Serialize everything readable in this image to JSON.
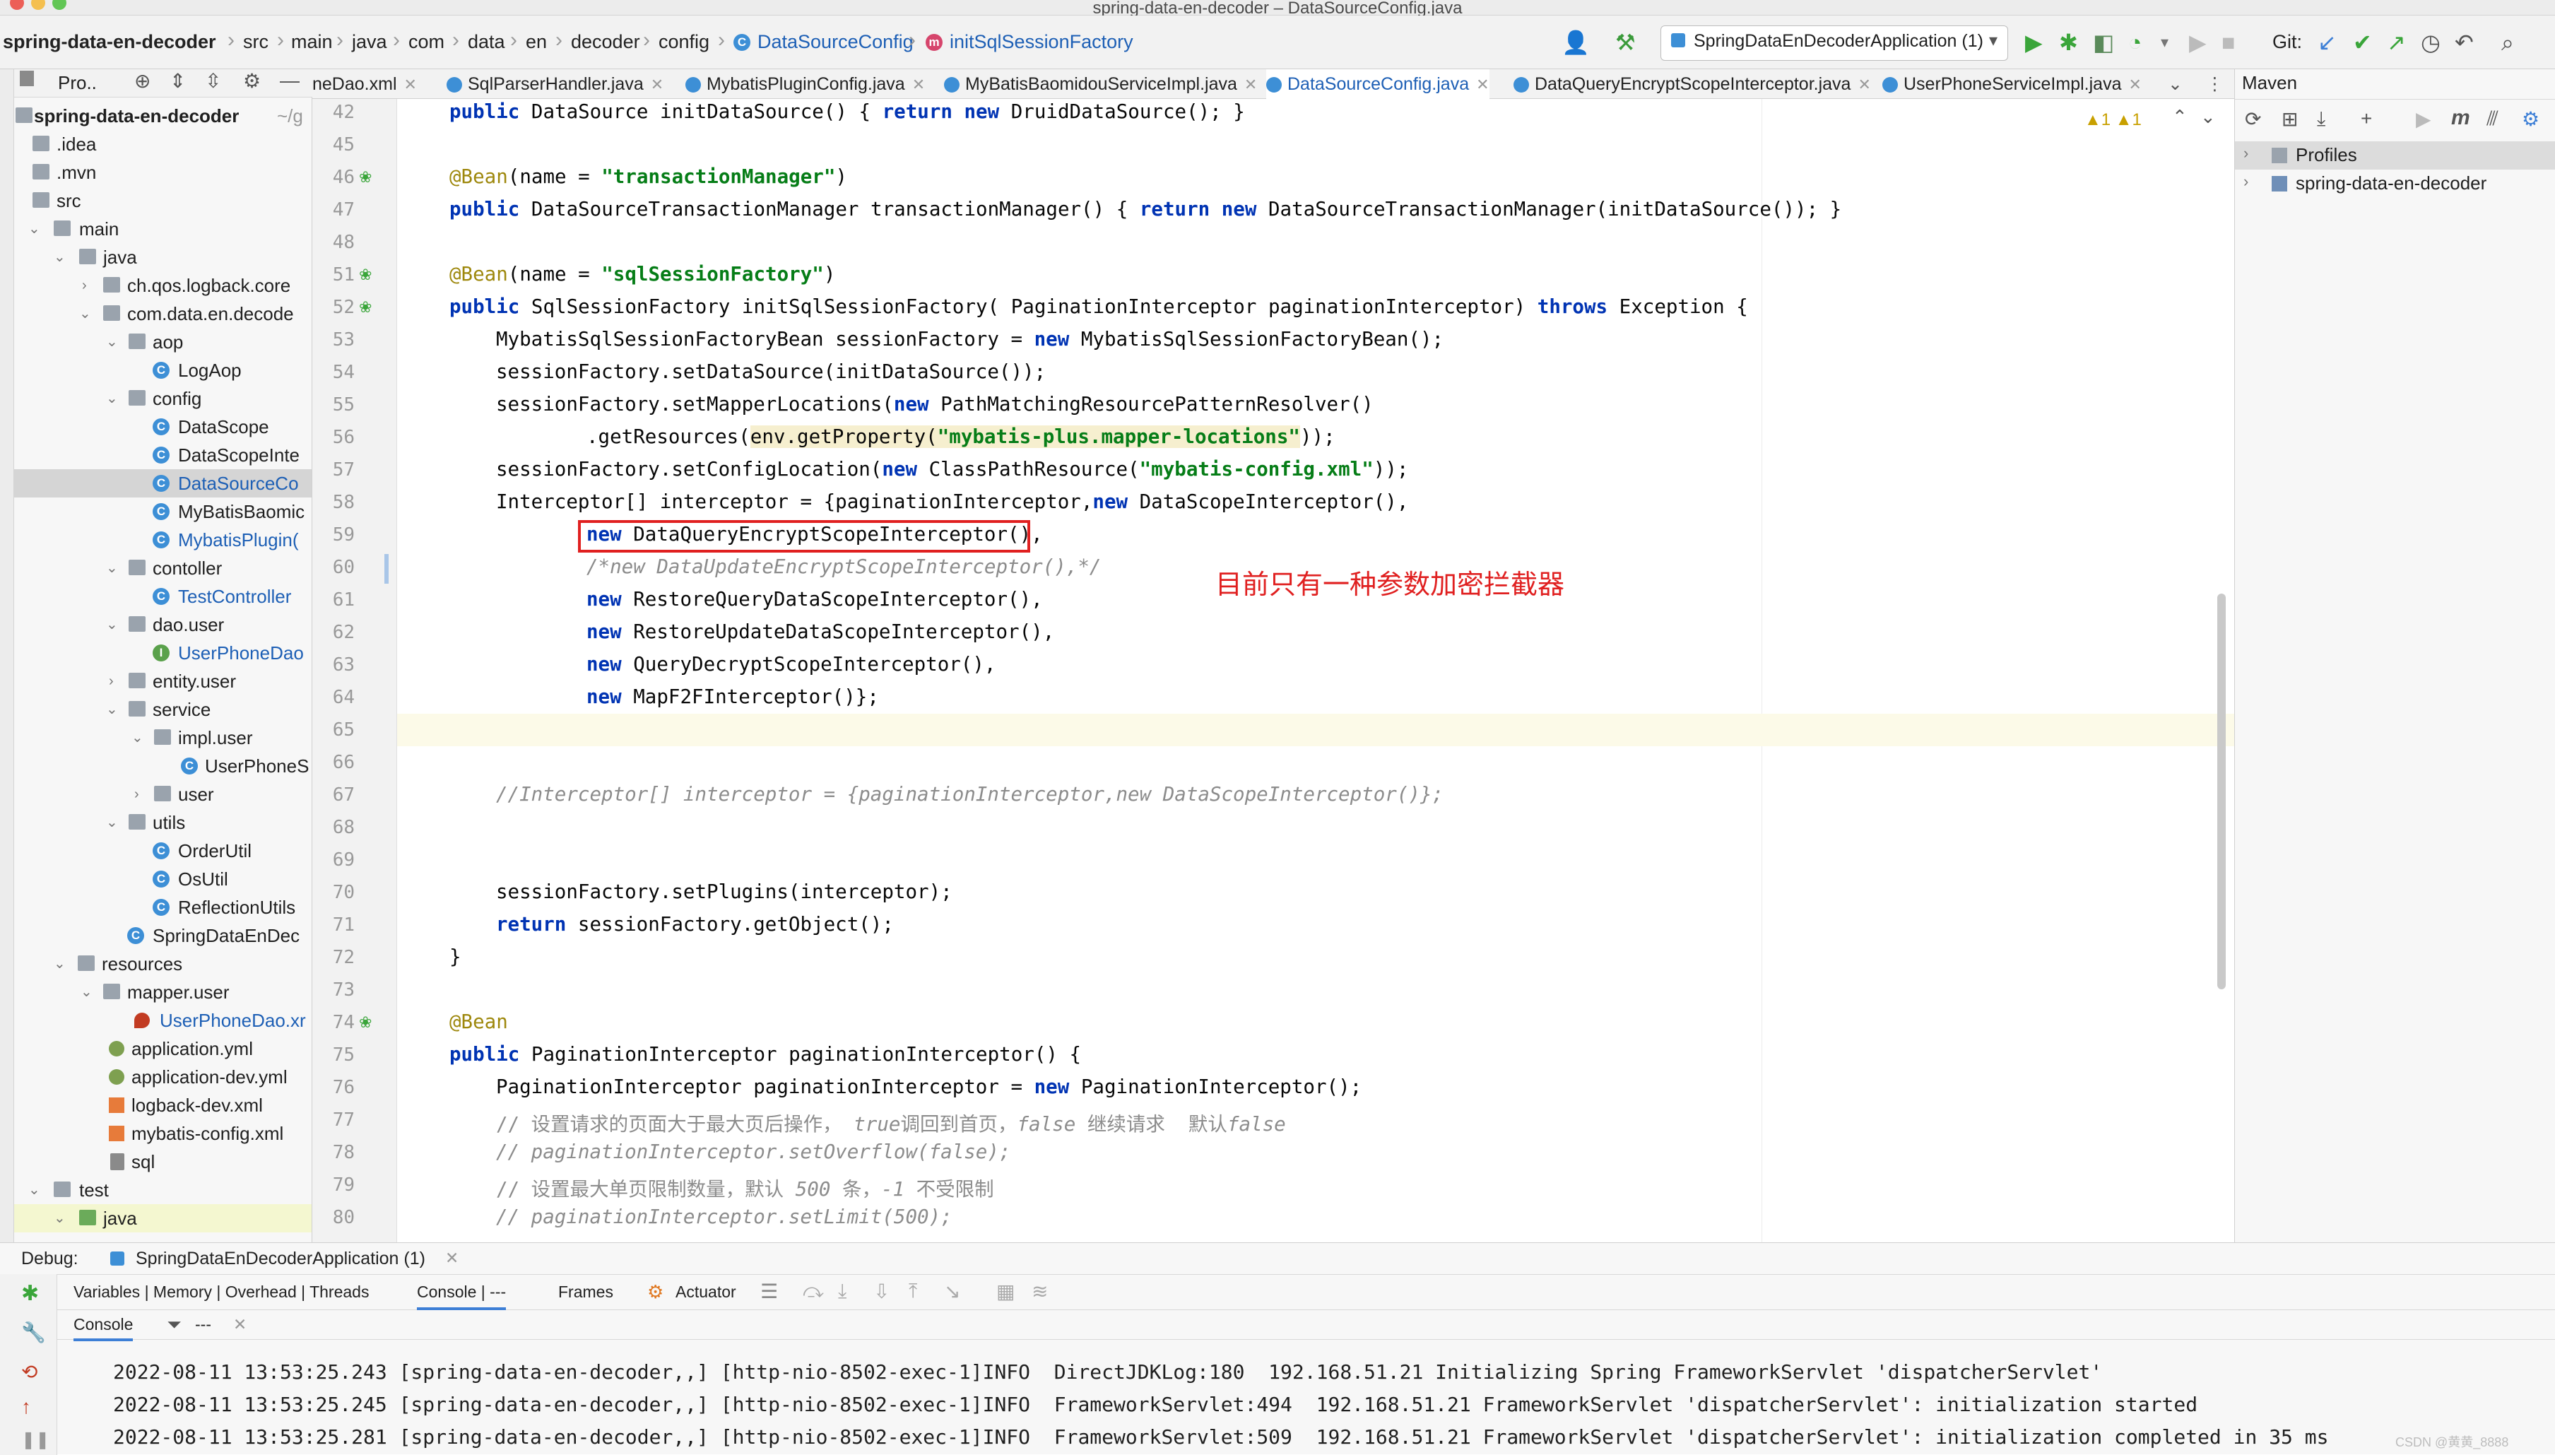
{
  "window": {
    "title": "spring-data-en-decoder – DataSourceConfig.java"
  },
  "breadcrumbs": [
    "spring-data-en-decoder",
    "src",
    "main",
    "java",
    "com",
    "data",
    "en",
    "decoder",
    "config",
    "DataSourceConfig",
    "initSqlSessionFactory"
  ],
  "toolbar": {
    "run_config": "SpringDataEnDecoderApplication (1)",
    "git_label": "Git:"
  },
  "project": {
    "header": "Pro..",
    "root": "spring-data-en-decoder",
    "root_suffix": "~/g",
    "items": [
      ".idea",
      ".mvn",
      "src",
      "main",
      "java",
      "ch.qos.logback.core",
      "com.data.en.decode",
      "aop",
      "LogAop",
      "config",
      "DataScope",
      "DataScopeInte",
      "DataSourceCo",
      "MyBatisBaomic",
      "MybatisPlugin(",
      "contoller",
      "TestController",
      "dao.user",
      "UserPhoneDao",
      "entity.user",
      "service",
      "impl.user",
      "UserPhoneS",
      "user",
      "utils",
      "OrderUtil",
      "OsUtil",
      "ReflectionUtils",
      "SpringDataEnDec",
      "resources",
      "mapper.user",
      "UserPhoneDao.xr",
      "application.yml",
      "application-dev.yml",
      "logback-dev.xml",
      "mybatis-config.xml",
      "sql",
      "test",
      "java"
    ]
  },
  "tabs": [
    "neDao.xml",
    "SqlParserHandler.java",
    "MybatisPluginConfig.java",
    "MyBatisBaomidouServiceImpl.java",
    "DataSourceConfig.java",
    "DataQueryEncryptScopeInterceptor.java",
    "UserPhoneServiceImpl.java"
  ],
  "editor": {
    "warnings": "▲1  ▲1",
    "line_numbers": [
      "42",
      "45",
      "46",
      "47",
      "48",
      "51",
      "52",
      "53",
      "54",
      "55",
      "56",
      "57",
      "58",
      "59",
      "60",
      "61",
      "62",
      "63",
      "64",
      "65",
      "66",
      "67",
      "68",
      "69",
      "70",
      "71",
      "72",
      "73",
      "74",
      "75",
      "76",
      "77",
      "78",
      "79",
      "80"
    ],
    "code": {
      "l42_a": "public",
      "l42_b": " DataSource initDataSource() { ",
      "l42_c": "return new",
      "l42_d": " DruidDataSource(); }",
      "l46_a": "@Bean",
      "l46_b": "(name = ",
      "l46_c": "\"transactionManager\"",
      "l46_d": ")",
      "l47_a": "public",
      "l47_b": " DataSourceTransactionManager transactionManager() { ",
      "l47_c": "return new",
      "l47_d": " DataSourceTransactionManager(initDataSource()); }",
      "l51_a": "@Bean",
      "l51_b": "(name = ",
      "l51_c": "\"sqlSessionFactory\"",
      "l51_d": ")",
      "l52_a": "public",
      "l52_b": " SqlSessionFactory initSqlSessionFactory( PaginationInterceptor paginationInterceptor) ",
      "l52_c": "throws",
      "l52_d": " Exception {",
      "l53_a": "MybatisSqlSessionFactoryBean sessionFactory = ",
      "l53_b": "new",
      "l53_c": " MybatisSqlSessionFactoryBean();",
      "l54": "sessionFactory.setDataSource(initDataSource());",
      "l55_a": "sessionFactory.setMapperLocations(",
      "l55_b": "new",
      "l55_c": " PathMatchingResourcePatternResolver()",
      "l56_a": ".getResources(",
      "l56_b": "env.getProperty(",
      "l56_c": "\"mybatis-plus.mapper-locations\"",
      "l56_d": "));",
      "l57_a": "sessionFactory.setConfigLocation(",
      "l57_b": "new",
      "l57_c": " ClassPathResource(",
      "l57_d": "\"mybatis-config.xml\"",
      "l57_e": "));",
      "l58_a": "Interceptor[] interceptor = {paginationInterceptor,",
      "l58_b": "new",
      "l58_c": " DataScopeInterceptor(),",
      "l59_a": "new",
      "l59_b": " DataQueryEncryptScopeInterceptor(),",
      "l60": "/*new DataUpdateEncryptScopeInterceptor(),*/",
      "l61_a": "new",
      "l61_b": " RestoreQueryDataScopeInterceptor(),",
      "l62_a": "new",
      "l62_b": " RestoreUpdateDataScopeInterceptor(),",
      "l63_a": "new",
      "l63_b": " QueryDecryptScopeInterceptor(),",
      "l64_a": "new",
      "l64_b": " MapF2FInterceptor()};",
      "l67": "//Interceptor[] interceptor = {paginationInterceptor,new DataScopeInterceptor()};",
      "l70": "sessionFactory.setPlugins(interceptor);",
      "l71_a": "return",
      "l71_b": " sessionFactory.getObject();",
      "l72": "}",
      "l74": "@Bean",
      "l75_a": "public",
      "l75_b": " PaginationInterceptor paginationInterceptor() {",
      "l76_a": "PaginationInterceptor paginationInterceptor = ",
      "l76_b": "new",
      "l76_c": " PaginationInterceptor();",
      "l77_a": "// 设置请求的页面大于最大页后操作， ",
      "l77_b": "true",
      "l77_c": "调回到首页，",
      "l77_d": "false",
      "l77_e": " 继续请求  默认",
      "l77_f": "false",
      "l78": "// paginationInterceptor.setOverflow(false);",
      "l79_a": "// 设置最大单页限制数量，默认 ",
      "l79_b": "500",
      "l79_c": " 条，",
      "l79_d": "-1",
      "l79_e": " 不受限制",
      "l80": "// paginationInterceptor.setLimit(500);"
    },
    "annotation_note": "目前只有一种参数加密拦截器"
  },
  "maven": {
    "title": "Maven",
    "items": [
      "Profiles",
      "spring-data-en-decoder"
    ]
  },
  "debug": {
    "label": "Debug:",
    "session": "SpringDataEnDecoderApplication (1)",
    "tabs": [
      "Variables | Memory | Overhead | Threads",
      "Console | ---",
      "Frames",
      "Actuator"
    ],
    "console_tab": "Console",
    "filter": "---",
    "logs": [
      "2022-08-11 13:53:25.243 [spring-data-en-decoder,,] [http-nio-8502-exec-1]INFO  DirectJDKLog:180  192.168.51.21 Initializing Spring FrameworkServlet 'dispatcherServlet'",
      "2022-08-11 13:53:25.245 [spring-data-en-decoder,,] [http-nio-8502-exec-1]INFO  FrameworkServlet:494  192.168.51.21 FrameworkServlet 'dispatcherServlet': initialization started",
      "2022-08-11 13:53:25.281 [spring-data-en-decoder,,] [http-nio-8502-exec-1]INFO  FrameworkServlet:509  192.168.51.21 FrameworkServlet 'dispatcherServlet': initialization completed in 35 ms"
    ],
    "watermark": "CSDN @黄黄_8888"
  },
  "colors": {
    "accent": "#3d7fd6",
    "annotation_red": "#e02020",
    "keyword": "#0033b3",
    "string": "#067d17"
  }
}
